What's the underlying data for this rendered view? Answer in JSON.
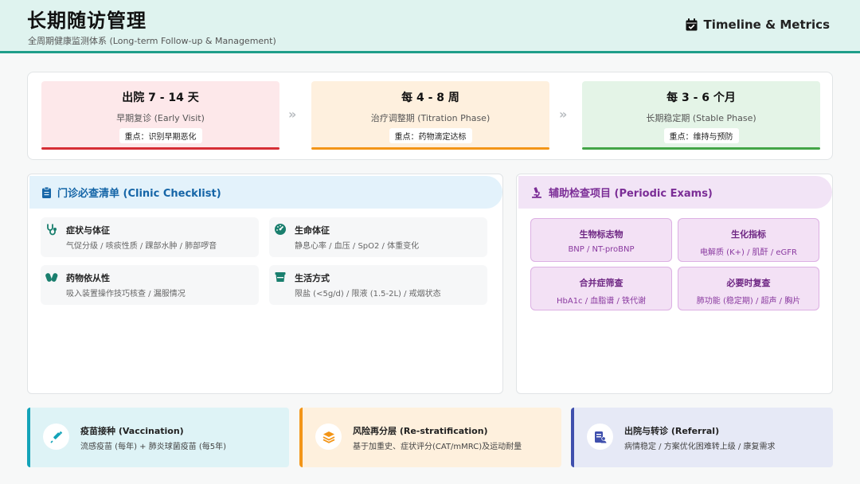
{
  "header": {
    "title": "长期随访管理",
    "subtitle": "全周期健康监测体系 (Long-term Follow-up & Management)",
    "right_label": "Timeline & Metrics",
    "right_icon": "calendar-check-icon"
  },
  "timeline": {
    "phases": [
      {
        "title": "出院 7 - 14 天",
        "subtitle": "早期复诊 (Early Visit)",
        "focus": "重点：识别早期恶化",
        "color": "#d62e35"
      },
      {
        "title": "每 4 - 8 周",
        "subtitle": "治疗调整期 (Titration Phase)",
        "focus": "重点：药物滴定达标",
        "color": "#f39517"
      },
      {
        "title": "每 3 - 6 个月",
        "subtitle": "长期稳定期 (Stable Phase)",
        "focus": "重点：维持与预防",
        "color": "#43a547"
      }
    ],
    "arrow_glyph": "»"
  },
  "checklist": {
    "title": "门诊必查清单 (Clinic Checklist)",
    "icon": "clipboard-icon",
    "items": [
      {
        "title": "症状与体征",
        "desc": "气促分级 / 咳痰性质 / 踝部水肿 / 肺部啰音",
        "icon": "stethoscope-icon"
      },
      {
        "title": "生命体征",
        "desc": "静息心率 / 血压 / SpO2 / 体重变化",
        "icon": "gauge-icon"
      },
      {
        "title": "药物依从性",
        "desc": "吸入装置操作技巧核查 / 漏服情况",
        "icon": "pills-icon"
      },
      {
        "title": "生活方式",
        "desc": "限盐 (<5g/d) / 限液 (1.5-2L) / 戒烟状态",
        "icon": "cup-icon"
      }
    ]
  },
  "exams": {
    "title": "辅助检查项目 (Periodic Exams)",
    "icon": "microscope-icon",
    "items": [
      {
        "title": "生物标志物",
        "desc": "BNP / NT-proBNP"
      },
      {
        "title": "生化指标",
        "desc": "电解质 (K+) / 肌酐 / eGFR"
      },
      {
        "title": "合并症筛查",
        "desc": "HbA1c / 血脂谱 / 铁代谢"
      },
      {
        "title": "必要时复查",
        "desc": "肺功能 (稳定期) / 超声 / 胸片"
      }
    ]
  },
  "bottom": [
    {
      "title": "疫苗接种 (Vaccination)",
      "desc": "流感疫苗 (每年) + 肺炎球菌疫苗 (每5年)",
      "icon": "syringe-icon",
      "color": "#13a3b8"
    },
    {
      "title": "风险再分层 (Re-stratification)",
      "desc": "基于加重史、症状评分(CAT/mMRC)及运动耐量",
      "icon": "layers-icon",
      "color": "#f39517"
    },
    {
      "title": "出院与转诊 (Referral)",
      "desc": "病情稳定 / 方案优化困难转上级 / 康复需求",
      "icon": "referral-icon",
      "color": "#3f4fad"
    }
  ]
}
